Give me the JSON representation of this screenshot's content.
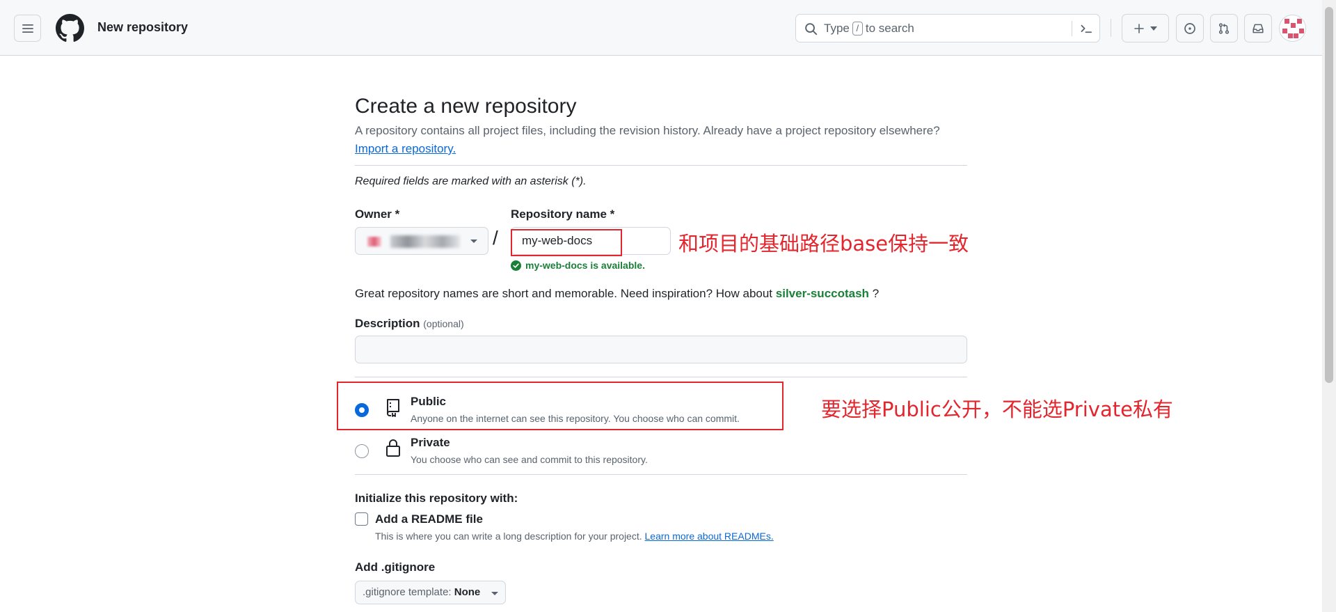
{
  "header": {
    "context_title": "New repository",
    "search": {
      "prefix": "Type",
      "key": "/",
      "suffix": "to search"
    }
  },
  "main": {
    "title": "Create a new repository",
    "lead": "A repository contains all project files, including the revision history. Already have a project repository elsewhere?",
    "import_link": "Import a repository.",
    "required_note": "Required fields are marked with an asterisk (*).",
    "owner_label": "Owner *",
    "repo_label": "Repository name *",
    "repo_value": "my-web-docs",
    "availability": "my-web-docs is available.",
    "great_prefix": "Great repository names are short and memorable. Need inspiration? How about",
    "suggestion": "silver-succotash",
    "great_suffix": "?",
    "description_label": "Description",
    "description_optional": "(optional)",
    "description_value": "",
    "visibility": [
      {
        "title": "Public",
        "desc": "Anyone on the internet can see this repository. You choose who can commit.",
        "selected": true
      },
      {
        "title": "Private",
        "desc": "You choose who can see and commit to this repository.",
        "selected": false
      }
    ],
    "init_title": "Initialize this repository with:",
    "readme_label": "Add a README file",
    "readme_checked": false,
    "readme_note": "This is where you can write a long description for your project.",
    "readme_link": "Learn more about READMEs.",
    "gitignore_title": "Add .gitignore",
    "gitignore_prefix": ".gitignore template:",
    "gitignore_value": "None"
  },
  "annotations": {
    "repo_name_note": "和项目的基础路径base保持一致",
    "visibility_note": "要选择Public公开，不能选Private私有"
  },
  "colors": {
    "accent": "#0969da",
    "success": "#1a7f37",
    "annotation_red": "#e3262e",
    "header_bg": "#f6f8fa",
    "border": "#d0d7de"
  },
  "icons": [
    "hamburger-icon",
    "github-logo-icon",
    "search-icon",
    "command-palette-icon",
    "plus-icon",
    "issues-icon",
    "pull-requests-icon",
    "inbox-icon",
    "check-circle-icon",
    "repo-icon",
    "lock-icon"
  ]
}
